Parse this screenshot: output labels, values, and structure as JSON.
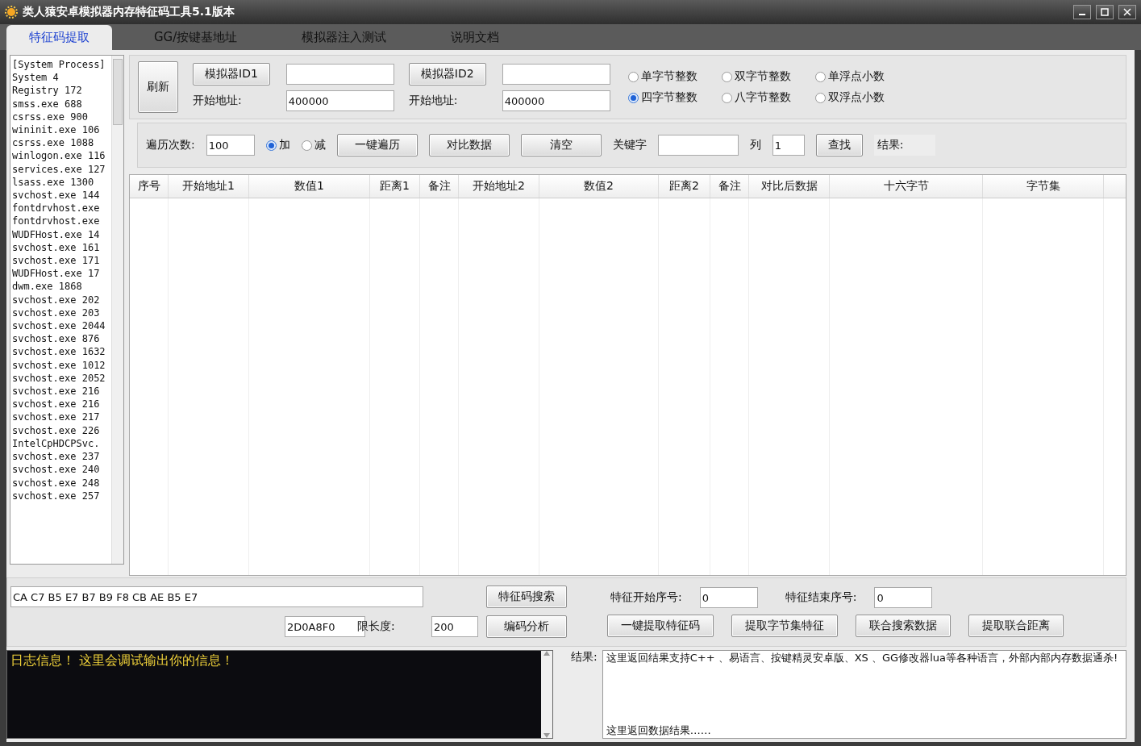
{
  "window": {
    "title": "类人猿安卓模拟器内存特征码工具5.1版本"
  },
  "tabs": [
    {
      "label": "特征码提取",
      "selected": true
    },
    {
      "label": "GG/按键基地址",
      "selected": false
    },
    {
      "label": "模拟器注入测试",
      "selected": false
    },
    {
      "label": "说明文档",
      "selected": false
    }
  ],
  "process_list": [
    "[System Process]",
    "System 4",
    "Registry 172",
    "smss.exe 688",
    "csrss.exe 900",
    "wininit.exe 106",
    "csrss.exe 1088",
    "winlogon.exe 116",
    "services.exe 127",
    "lsass.exe 1300",
    "svchost.exe 144",
    "fontdrvhost.exe",
    "fontdrvhost.exe",
    "WUDFHost.exe 14",
    "svchost.exe 161",
    "svchost.exe 171",
    "WUDFHost.exe 17",
    "dwm.exe 1868",
    "svchost.exe 202",
    "svchost.exe 203",
    "svchost.exe 2044",
    "svchost.exe 876",
    "svchost.exe 1632",
    "svchost.exe 1012",
    "svchost.exe 2052",
    "svchost.exe 216",
    "svchost.exe 216",
    "svchost.exe 217",
    "svchost.exe 226",
    "IntelCpHDCPSvc.",
    "svchost.exe 237",
    "svchost.exe 240",
    "svchost.exe 248",
    "svchost.exe 257"
  ],
  "refresh_button": "刷新",
  "emulators": [
    {
      "button": "模拟器ID1",
      "start_label": "开始地址:",
      "start_value": "400000"
    },
    {
      "button": "模拟器ID2",
      "start_label": "开始地址:",
      "start_value": "400000"
    }
  ],
  "value_types": [
    {
      "label": "单字节整数",
      "selected": false
    },
    {
      "label": "双字节整数",
      "selected": false
    },
    {
      "label": "单浮点小数",
      "selected": false
    },
    {
      "label": "四字节整数",
      "selected": true
    },
    {
      "label": "八字节整数",
      "selected": false
    },
    {
      "label": "双浮点小数",
      "selected": false
    }
  ],
  "traverse": {
    "count_label": "遍历次数:",
    "count_value": "100",
    "directions": [
      {
        "label": "加",
        "selected": true
      },
      {
        "label": "减",
        "selected": false
      }
    ],
    "buttons": [
      "一键遍历",
      "对比数据",
      "清空"
    ],
    "keyword_label": "关键字",
    "column_label": "列",
    "column_value": "1",
    "find_button": "查找",
    "result_label": "结果:"
  },
  "table": {
    "columns": [
      "序号",
      "开始地址1",
      "数值1",
      "距离1",
      "备注",
      "开始地址2",
      "数值2",
      "距离2",
      "备注",
      "对比后数据",
      "十六字节",
      "字节集"
    ]
  },
  "feature": {
    "hex_value": "CA C7 B5 E7 B7 B9 F8 CB AE B5 E7",
    "search_button": "特征码搜索",
    "distance_value": "2D0A8F0",
    "limit_label": "限长度:",
    "limit_value": "200",
    "analyze_button": "编码分析",
    "start_index_label": "特征开始序号:",
    "start_index_value": "0",
    "end_index_label": "特征结束序号:",
    "end_index_value": "0",
    "buttons": [
      "一键提取特征码",
      "提取字节集特征",
      "联合搜索数据",
      "提取联合距离"
    ]
  },
  "log": {
    "text": "日志信息！  这里会调试输出你的信息！"
  },
  "result": {
    "label": "结果:",
    "lines": [
      "这里返回结果支持C++ 、易语言、按键精灵安卓版、XS 、GG修改器lua等各种语言，外部内部内存数据通杀!",
      "这里返回数据结果……"
    ]
  }
}
